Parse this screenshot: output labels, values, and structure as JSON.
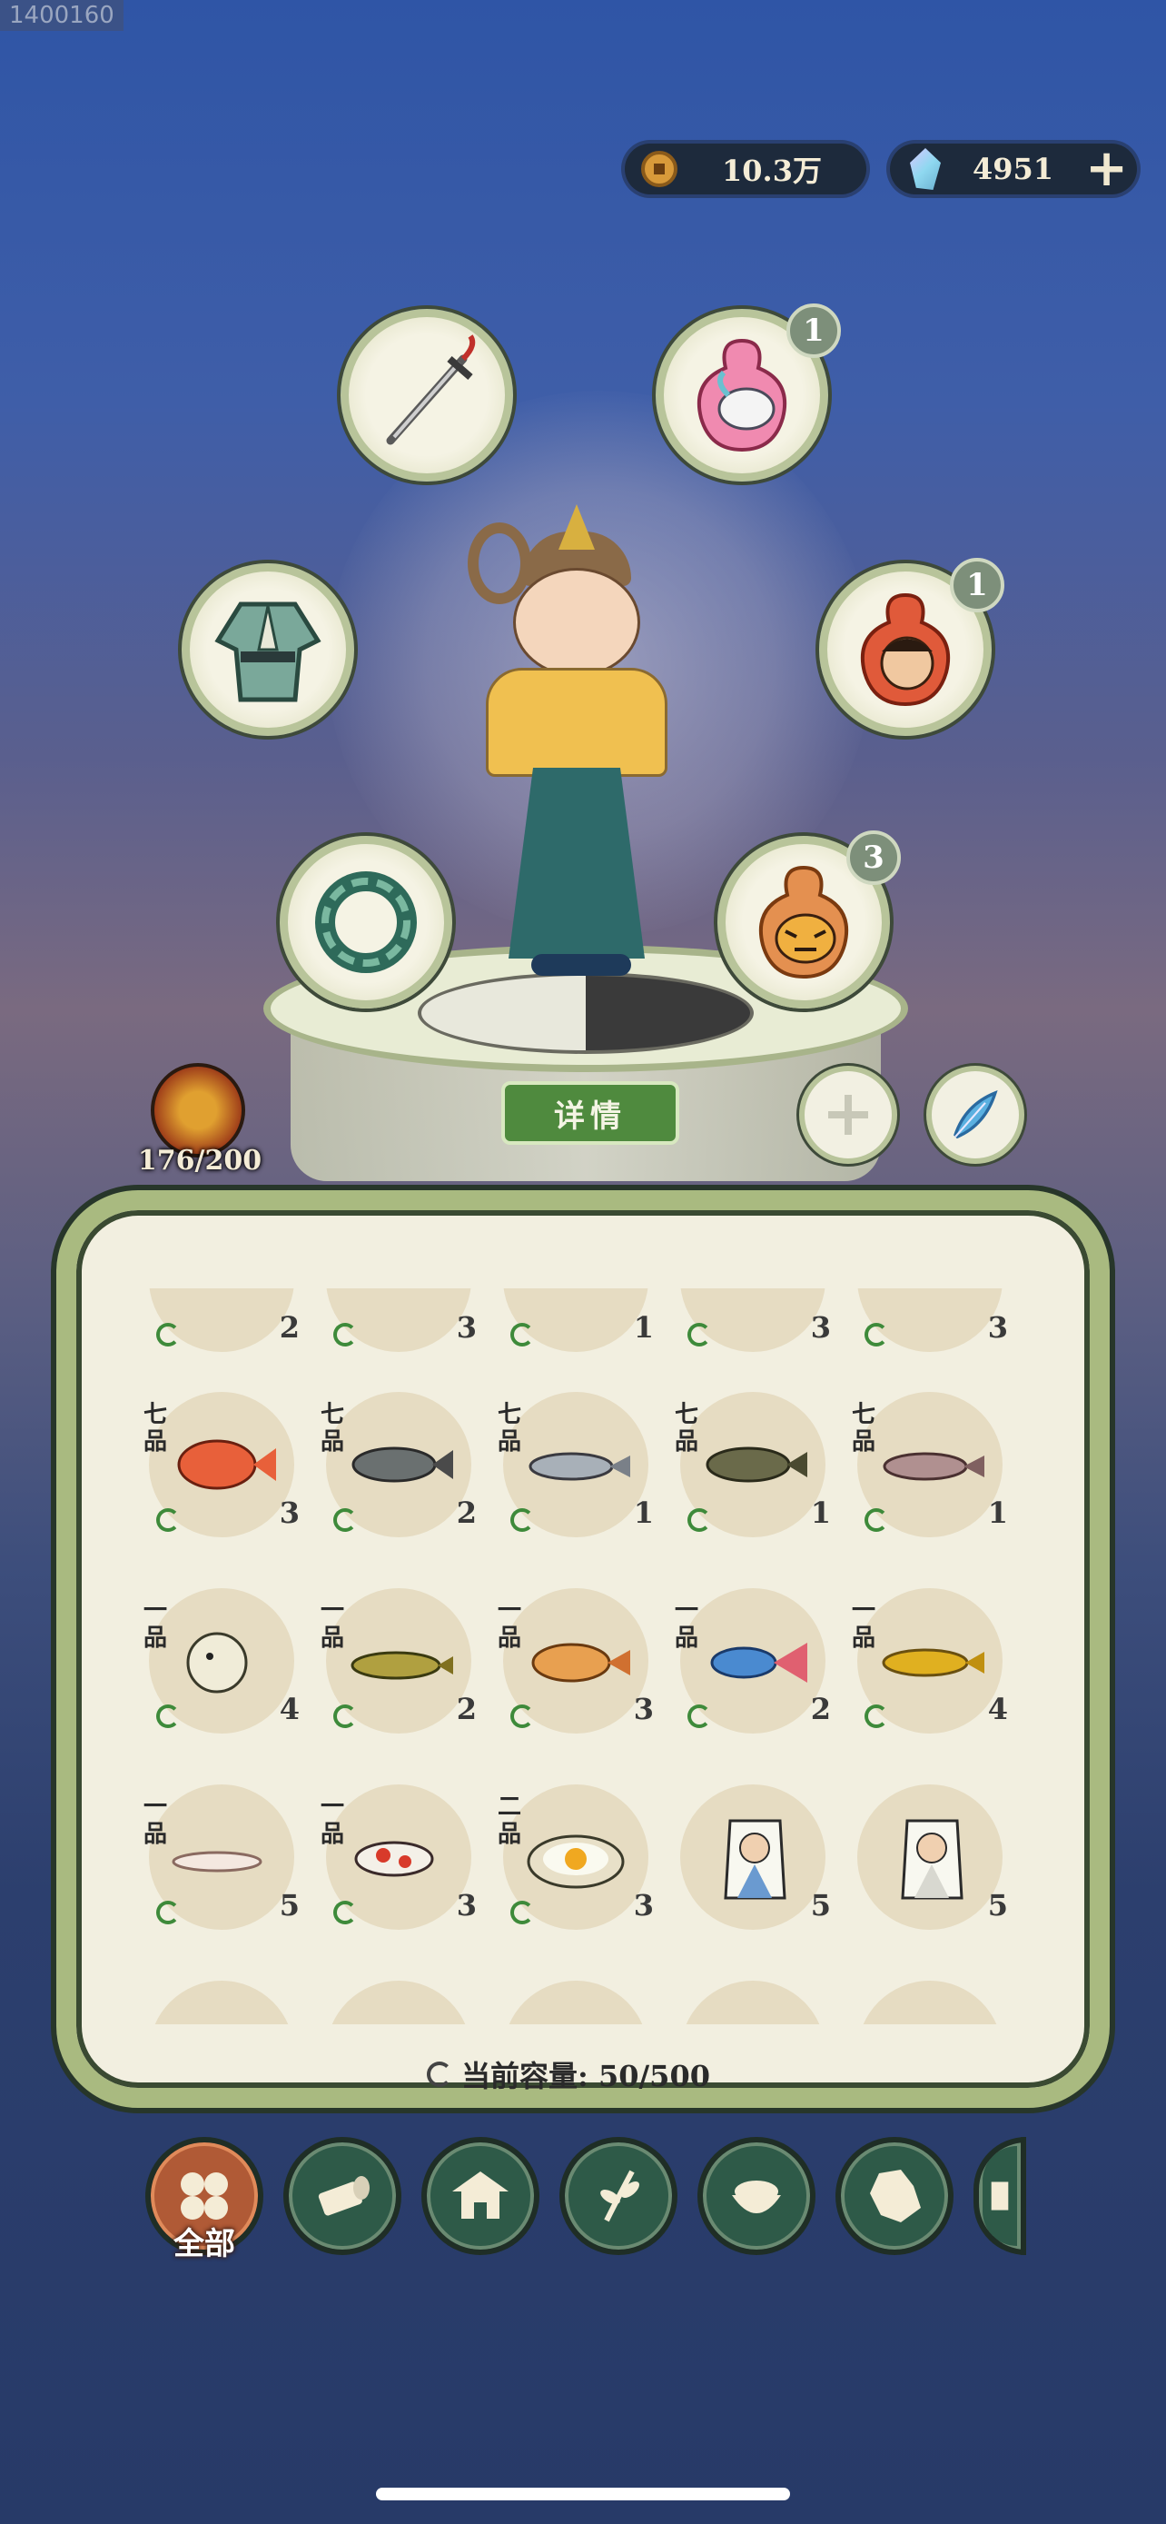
{
  "corner_id": "1400160",
  "currency": {
    "coins": {
      "icon": "copper-coin-icon",
      "value": "10.3万"
    },
    "gems": {
      "icon": "jade-gem-icon",
      "value": "4951",
      "add_icon": "plus-icon"
    }
  },
  "equipment": {
    "weapon": {
      "icon": "sword-icon"
    },
    "armor": {
      "icon": "robe-armor-icon"
    },
    "accessory": {
      "icon": "jade-bracelet-icon"
    },
    "pet_goat": {
      "icon": "white-goat-gourd-icon",
      "count": "1"
    },
    "pet_hero": {
      "icon": "warrior-gourd-icon",
      "count": "1"
    },
    "pet_tiger": {
      "icon": "tiger-gourd-icon",
      "count": "3"
    }
  },
  "detail_button": "详情",
  "level": {
    "icon": "demon-mask-icon",
    "text": "176/200"
  },
  "capacity": {
    "label": "当前容量: 50/500"
  },
  "inventory": {
    "row0": [
      {
        "icon": "item-partial-icon",
        "count": "2"
      },
      {
        "icon": "item-partial-icon",
        "count": "3"
      },
      {
        "icon": "item-partial-icon",
        "count": "1"
      },
      {
        "icon": "item-partial-icon",
        "count": "3"
      },
      {
        "icon": "item-partial-icon",
        "count": "3"
      }
    ],
    "row1": [
      {
        "rank": "七品",
        "icon": "red-flowerhorn-fish-icon",
        "count": "3"
      },
      {
        "rank": "七品",
        "icon": "grass-carp-icon",
        "count": "2"
      },
      {
        "rank": "七品",
        "icon": "silver-fish-icon",
        "count": "1"
      },
      {
        "rank": "七品",
        "icon": "mandarin-fish-icon",
        "count": "1"
      },
      {
        "rank": "七品",
        "icon": "salmon-icon",
        "count": "1"
      }
    ],
    "row2": [
      {
        "rank": "一品",
        "icon": "pufferfish-icon",
        "count": "4"
      },
      {
        "rank": "一品",
        "icon": "catfish-icon",
        "count": "2"
      },
      {
        "rank": "一品",
        "icon": "gourami-icon",
        "count": "3"
      },
      {
        "rank": "一品",
        "icon": "paradise-fish-icon",
        "count": "2"
      },
      {
        "rank": "一品",
        "icon": "golden-arowana-icon",
        "count": "4"
      }
    ],
    "row3": [
      {
        "rank": "一品",
        "icon": "axolotl-icon",
        "count": "5"
      },
      {
        "rank": "一品",
        "icon": "koi-icon",
        "count": "3"
      },
      {
        "rank": "二品",
        "icon": "fried-egg-dish-icon",
        "count": "3"
      },
      {
        "rank": "",
        "icon": "scholar-portrait-icon",
        "count": "5"
      },
      {
        "rank": "",
        "icon": "elder-portrait-icon",
        "count": "5"
      }
    ]
  },
  "tabs": [
    {
      "icon": "all-items-icon",
      "label": "全部",
      "active": true
    },
    {
      "icon": "wood-log-icon"
    },
    {
      "icon": "house-icon"
    },
    {
      "icon": "herb-icon"
    },
    {
      "icon": "rice-bowl-icon"
    },
    {
      "icon": "ore-icon"
    },
    {
      "icon": "scroll-icon"
    }
  ],
  "colors": {
    "panel_border": "#a9ba80",
    "panel_bg": "#f2efe0",
    "detail_button": "#4f8a3e",
    "active_tab": "#b05a36",
    "inactive_tab": "#2e5a48"
  }
}
